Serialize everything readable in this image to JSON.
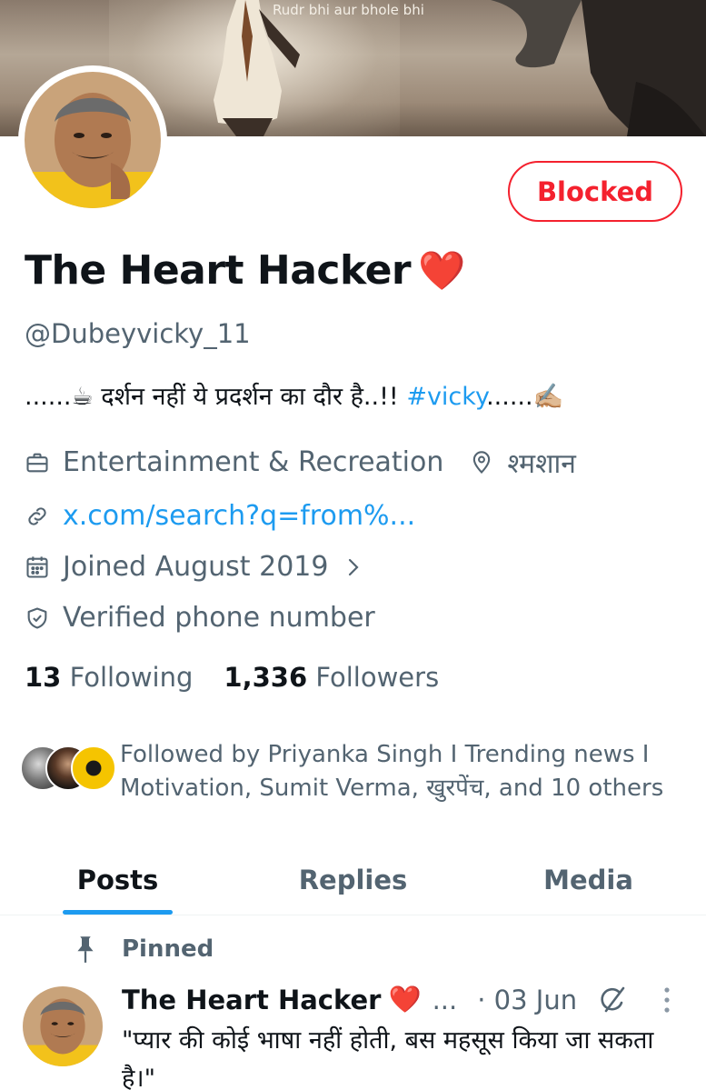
{
  "banner": {
    "caption": "Rudr bhi aur bhole bhi"
  },
  "profile": {
    "name": "The Heart Hacker",
    "name_emoji": "❤️",
    "handle": "@Dubeyvicky_11",
    "blocked_label": "Blocked",
    "bio_text": "......☕  दर्शन नहीं ये प्रदर्शन का दौर है..!! ",
    "bio_hashtag": "#vicky",
    "bio_suffix": "......✍🏼",
    "category": "Entertainment & Recreation",
    "location": "श्मशान",
    "website": "x.com/search?q=from%...",
    "joined": "Joined August 2019",
    "verified": "Verified phone number",
    "following_count": "13",
    "following_label": "Following",
    "followers_count": "1,336",
    "followers_label": "Followers",
    "followed_by": "Followed by Priyanka Singh I Trending news I Motivation, Sumit Verma, खुरपेंच, and 10 others"
  },
  "tabs": [
    {
      "label": "Posts",
      "active": true
    },
    {
      "label": "Replies",
      "active": false
    },
    {
      "label": "Media",
      "active": false
    }
  ],
  "pinned_label": "Pinned",
  "tweet": {
    "author": "The Heart Hacker",
    "author_emoji": "❤️",
    "ellipsis": "...",
    "date": "· 03 Jun",
    "text": "\"प्यार की कोई भाषा नहीं होती, बस महसूस किया जा सकता है।\""
  },
  "colors": {
    "accent": "#1d9bf0",
    "blocked": "#f4212e",
    "muted": "#536471"
  },
  "icons": [
    "briefcase-icon",
    "location-pin-icon",
    "link-icon",
    "calendar-icon",
    "chevron-right-icon",
    "verified-shield-icon",
    "pin-icon",
    "grok-icon",
    "more-icon"
  ]
}
